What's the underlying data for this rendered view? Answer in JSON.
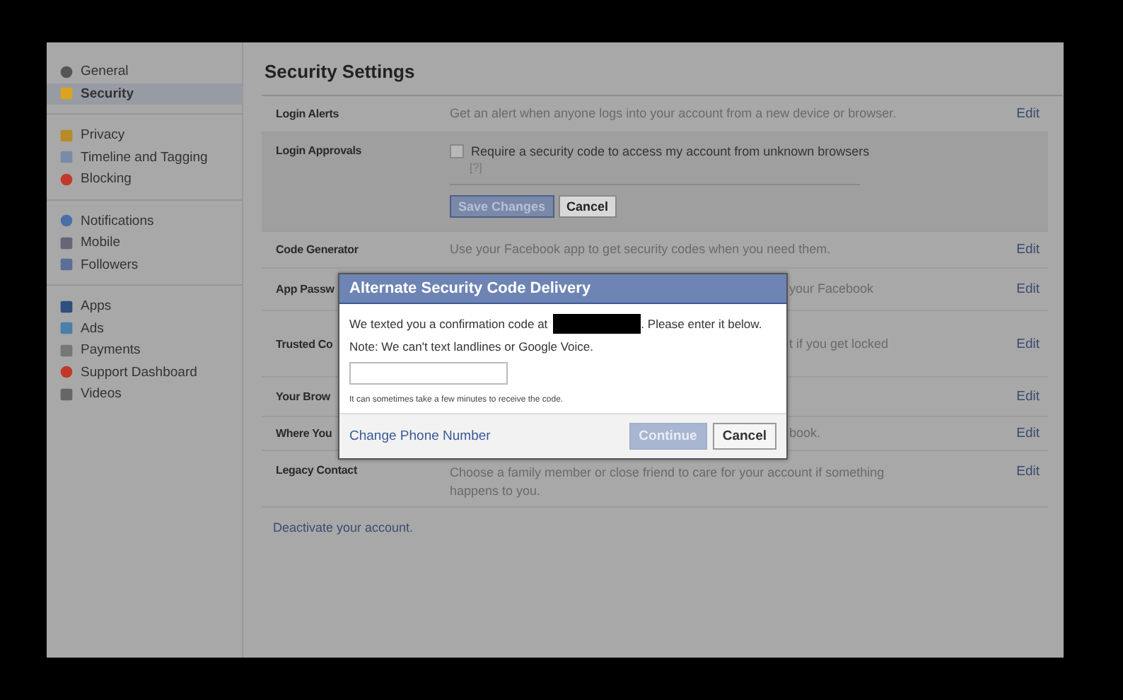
{
  "sidebar": {
    "groups": [
      {
        "items": [
          {
            "label": "General",
            "selected": false
          },
          {
            "label": "Security",
            "selected": true
          }
        ]
      },
      {
        "items": [
          {
            "label": "Privacy",
            "selected": false
          },
          {
            "label": "Timeline and Tagging",
            "selected": false
          },
          {
            "label": "Blocking",
            "selected": false
          }
        ]
      },
      {
        "items": [
          {
            "label": "Notifications",
            "selected": false
          },
          {
            "label": "Mobile",
            "selected": false
          },
          {
            "label": "Followers",
            "selected": false
          }
        ]
      },
      {
        "items": [
          {
            "label": "Apps",
            "selected": false
          },
          {
            "label": "Ads",
            "selected": false
          },
          {
            "label": "Payments",
            "selected": false
          },
          {
            "label": "Support Dashboard",
            "selected": false
          },
          {
            "label": "Videos",
            "selected": false
          }
        ]
      }
    ]
  },
  "title": "Security Settings",
  "rows": [
    {
      "kind": "plain",
      "label": "Login Alerts",
      "description": "Get an alert when anyone logs into your account from a new device or browser.",
      "action": "Edit"
    },
    {
      "kind": "expanded",
      "label": "Login Approvals",
      "option": {
        "label": "Require a security code to access my account from unknown browsers",
        "checked": false,
        "help": "[?]"
      },
      "buttons": [
        {
          "label": "Save Changes",
          "kind": "primary",
          "disabled": true
        },
        {
          "label": "Cancel",
          "kind": "secondary",
          "disabled": false
        }
      ]
    },
    {
      "kind": "plain",
      "label": "Code Generator",
      "description": "Use your Facebook app to get security codes when you need them.",
      "action": "Edit"
    },
    {
      "kind": "partial",
      "label": "App Passw",
      "description": "your Facebook",
      "action": "Edit"
    },
    {
      "kind": "partial",
      "label": "Trusted Co",
      "description": "t if you get locked",
      "action": "Edit"
    },
    {
      "kind": "partial",
      "label": "Your Brow",
      "action": "Edit"
    },
    {
      "kind": "partial",
      "label": "Where You",
      "description": "book.",
      "action": "Edit"
    },
    {
      "kind": "plain",
      "label": "Legacy Contact",
      "description": "Choose a family member or close friend to care for your account if something happens to you.",
      "action": "Edit"
    }
  ],
  "footer_link": "Deactivate your account.",
  "dialog": {
    "title": "Alternate Security Code Delivery",
    "message_before": "We texted you a confirmation code at",
    "message_after": ". Please enter it below.",
    "redacted": true,
    "note": "Note: We can't text landlines or Google Voice.",
    "hint": "It can sometimes take a few minutes to receive the code.",
    "link": "Change Phone Number",
    "buttons": [
      {
        "label": "Continue",
        "kind": "primary",
        "disabled": true
      },
      {
        "label": "Cancel",
        "kind": "secondary",
        "disabled": false
      }
    ]
  }
}
